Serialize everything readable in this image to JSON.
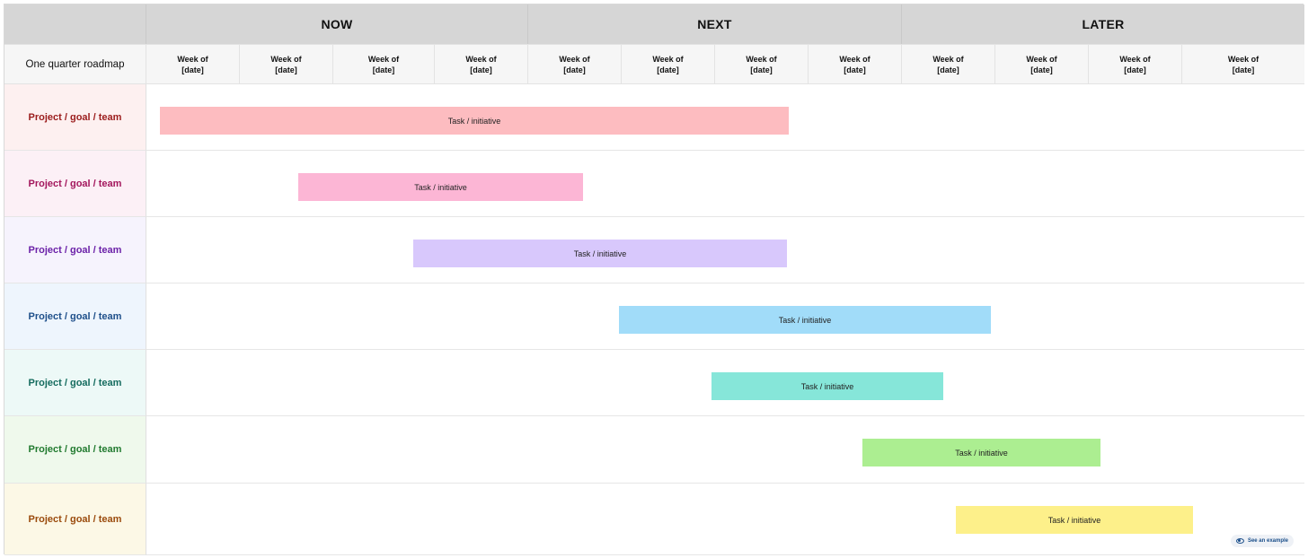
{
  "board": {
    "corner_label": "One quarter roadmap",
    "phases": [
      "NOW",
      "NEXT",
      "LATER"
    ],
    "week_label": {
      "line1": "Week of",
      "line2": "[date]"
    },
    "week_count": 12,
    "rows": [
      {
        "label": "Project / goal / team",
        "label_color": "#9b1c1c",
        "bg": "#fdf0f0",
        "task": "Task / initiative",
        "bar_color": "#fdbcc0"
      },
      {
        "label": "Project / goal / team",
        "label_color": "#a3175d",
        "bg": "#fcf0f6",
        "task": "Task / initiative",
        "bar_color": "#fcb6d5"
      },
      {
        "label": "Project / goal / team",
        "label_color": "#6b21a8",
        "bg": "#f6f3fd",
        "task": "Task / initiative",
        "bar_color": "#d8c8fc"
      },
      {
        "label": "Project / goal / team",
        "label_color": "#1e4f8a",
        "bg": "#eef5fd",
        "task": "Task / initiative",
        "bar_color": "#a1dcf9"
      },
      {
        "label": "Project / goal / team",
        "label_color": "#146b5e",
        "bg": "#edf9f7",
        "task": "Task / initiative",
        "bar_color": "#86e6d9"
      },
      {
        "label": "Project / goal / team",
        "label_color": "#217a2f",
        "bg": "#eff9ec",
        "task": "Task / initiative",
        "bar_color": "#acee91"
      },
      {
        "label": "Project / goal / team",
        "label_color": "#9a4a0c",
        "bg": "#fcf8e6",
        "task": "Task / initiative",
        "bar_color": "#fdf08a"
      }
    ]
  },
  "example_button": {
    "label": "See an example",
    "icon": "eye-icon"
  }
}
